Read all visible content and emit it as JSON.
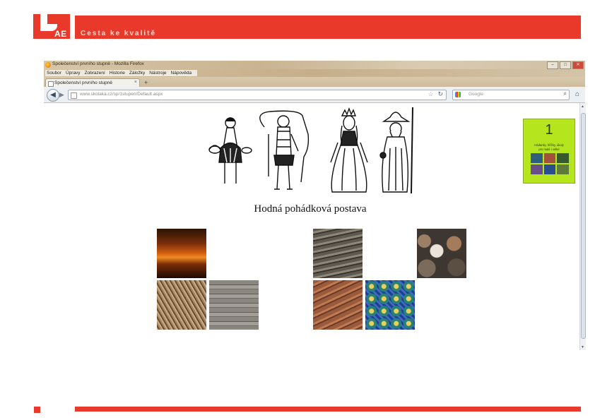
{
  "slide": {
    "logo_text": "AE",
    "tagline": "Cesta ke kvalitě",
    "accent_color": "#e8392a"
  },
  "browser": {
    "window_title": "Společenství prvního stupně - Mozilla Firefox",
    "menu": [
      "Soubor",
      "Úpravy",
      "Zobrazení",
      "Historie",
      "Záložky",
      "Nástroje",
      "Nápověda"
    ],
    "tab_label": "Společenství prvního stupně",
    "url": "www.skolaka.cz/sp/1stupen/Default.aspx",
    "search_placeholder": "Google",
    "window_buttons": [
      "–",
      "□",
      "✕"
    ]
  },
  "page": {
    "caption": "Hodná pohádková postava",
    "book": {
      "number": "1",
      "line1": "Hádanky, hříčky, úkoly",
      "line2": "pro malé i velké"
    },
    "tiles": [
      "sunset",
      "wooden-shingles",
      "pebbles",
      "twigs",
      "planks",
      "roof-tiles",
      "mosaic-tiles"
    ]
  },
  "icons": [
    "firefox-icon",
    "back-icon",
    "forward-icon",
    "star-icon",
    "reload-icon",
    "google-icon",
    "search-icon",
    "home-icon"
  ]
}
